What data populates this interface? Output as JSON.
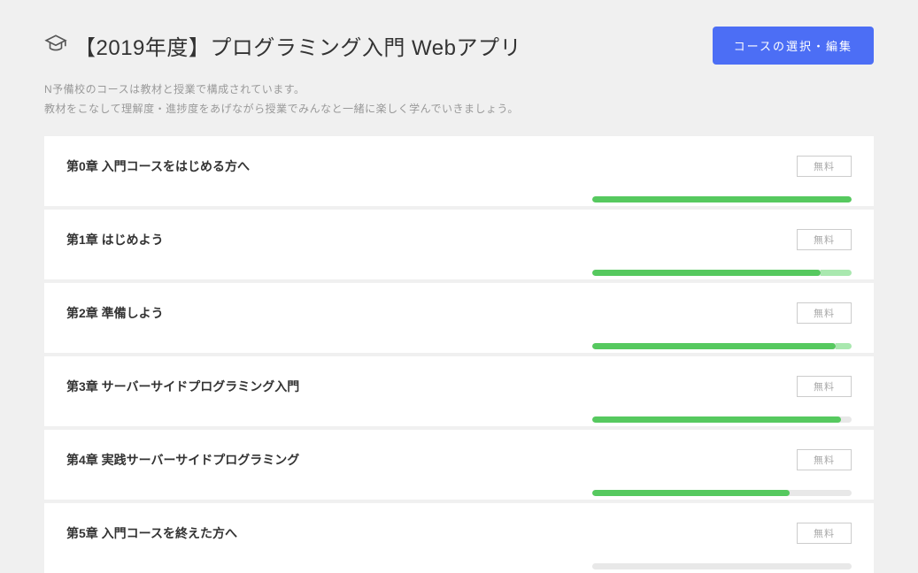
{
  "header": {
    "title": "【2019年度】プログラミング入門 Webアプリ",
    "edit_button": "コースの選択・編集",
    "description_line1": "N予備校のコースは教材と授業で構成されています。",
    "description_line2": "教材をこなして理解度・進捗度をあげながら授業でみんなと一緒に楽しく学んでいきましょう。"
  },
  "badge_label": "無料",
  "chapters": [
    {
      "title": "第0章 入門コースをはじめる方へ",
      "progress_main": 100,
      "progress_sub": 0
    },
    {
      "title": "第1章 はじめよう",
      "progress_main": 88,
      "progress_sub": 12
    },
    {
      "title": "第2章 準備しよう",
      "progress_main": 94,
      "progress_sub": 6
    },
    {
      "title": "第3章 サーバーサイドプログラミング入門",
      "progress_main": 96,
      "progress_sub": 0
    },
    {
      "title": "第4章 実践サーバーサイドプログラミング",
      "progress_main": 76,
      "progress_sub": 0
    },
    {
      "title": "第5章 入門コースを終えた方へ",
      "progress_main": 0,
      "progress_sub": 0
    }
  ]
}
